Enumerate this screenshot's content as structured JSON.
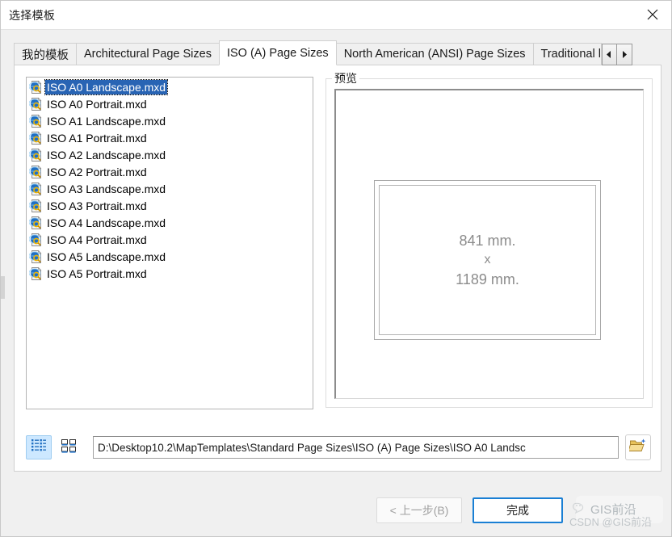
{
  "window": {
    "title": "选择模板",
    "close_icon": "close-icon"
  },
  "tabs": {
    "items": [
      {
        "label": "我的模板",
        "selected": false
      },
      {
        "label": "Architectural Page Sizes",
        "selected": false
      },
      {
        "label": "ISO (A) Page Sizes",
        "selected": true
      },
      {
        "label": "North American (ANSI) Page Sizes",
        "selected": false
      },
      {
        "label": "Traditional l",
        "selected": false
      }
    ],
    "scroll_left_icon": "chevron-left-icon",
    "scroll_right_icon": "chevron-right-icon"
  },
  "list": {
    "items": [
      {
        "name": "ISO A0 Landscape.mxd",
        "selected": true
      },
      {
        "name": "ISO A0 Portrait.mxd",
        "selected": false
      },
      {
        "name": "ISO A1 Landscape.mxd",
        "selected": false
      },
      {
        "name": "ISO A1 Portrait.mxd",
        "selected": false
      },
      {
        "name": "ISO A2 Landscape.mxd",
        "selected": false
      },
      {
        "name": "ISO A2 Portrait.mxd",
        "selected": false
      },
      {
        "name": "ISO A3 Landscape.mxd",
        "selected": false
      },
      {
        "name": "ISO A3 Portrait.mxd",
        "selected": false
      },
      {
        "name": "ISO A4 Landscape.mxd",
        "selected": false
      },
      {
        "name": "ISO A4 Portrait.mxd",
        "selected": false
      },
      {
        "name": "ISO A5 Landscape.mxd",
        "selected": false
      },
      {
        "name": "ISO A5 Portrait.mxd",
        "selected": false
      }
    ],
    "item_icon": "map-document-icon"
  },
  "preview": {
    "legend": "预览",
    "width_text": "841 mm.",
    "separator_text": "x",
    "height_text": "1189 mm."
  },
  "path_row": {
    "list_view_icon": "list-view-icon",
    "tile_view_icon": "tile-view-icon",
    "path_value": "D:\\Desktop10.2\\MapTemplates\\Standard Page Sizes\\ISO (A) Page Sizes\\ISO A0 Landsc",
    "browse_icon": "open-folder-icon"
  },
  "footer": {
    "back_label": "< 上一步(B)",
    "finish_label": "完成"
  },
  "watermark": {
    "main_text": "GIS前沿",
    "sub_text": "CSDN @GIS前沿"
  },
  "colors": {
    "selection_blue": "#2864b4",
    "default_button_border": "#1a7fd4",
    "active_toggle_bg": "#cde8ff",
    "dialog_bg": "#f0f0f0"
  }
}
